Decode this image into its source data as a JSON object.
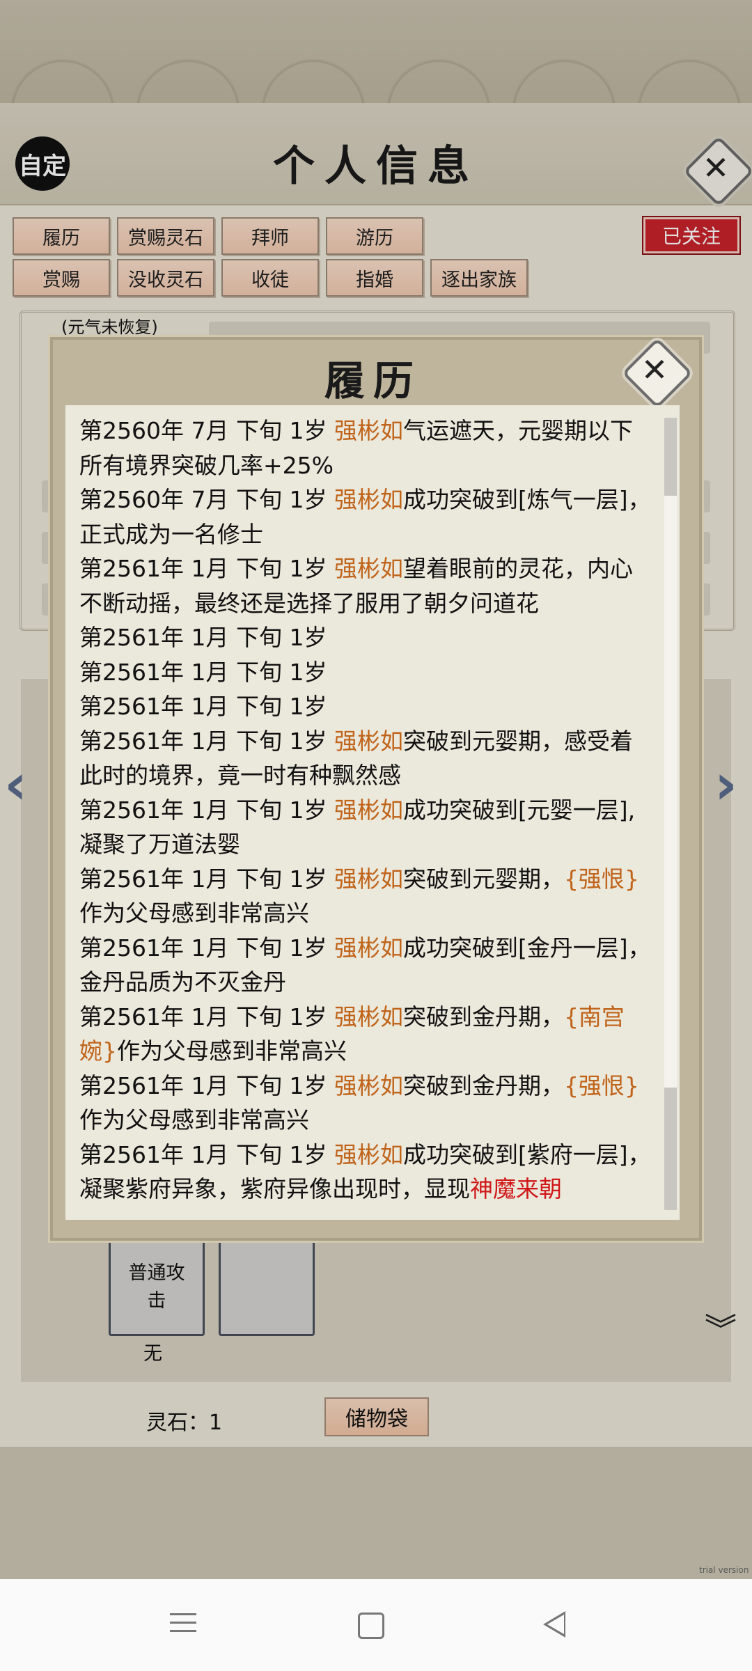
{
  "header": {
    "auto_label": "自定",
    "title": "个人信息"
  },
  "tabs_row1": [
    "履历",
    "赏赐灵石",
    "拜师",
    "游历"
  ],
  "tabs_row2": [
    "赏赐",
    "没收灵石",
    "收徒",
    "指婚",
    "逐出家族"
  ],
  "followed_label": "已关注",
  "status_note": "(元气未恢复)",
  "modal": {
    "title": "履历",
    "entries": [
      {
        "prefix": "第2560年 7月 下旬 1岁 ",
        "name": "强彬如",
        "text": "气运遮天，元婴期以下所有境界突破几率+25%"
      },
      {
        "prefix": "第2560年 7月 下旬 1岁 ",
        "name": "强彬如",
        "text": "成功突破到[炼气一层]，正式成为一名修士"
      },
      {
        "prefix": "第2561年 1月 下旬 1岁 ",
        "name": "强彬如",
        "text": "望着眼前的灵花，内心不断动摇，最终还是选择了服用了朝夕问道花"
      },
      {
        "prefix": "第2561年 1月 下旬 1岁",
        "name": "",
        "text": ""
      },
      {
        "prefix": "第2561年 1月 下旬 1岁",
        "name": "",
        "text": ""
      },
      {
        "prefix": "第2561年 1月 下旬 1岁",
        "name": "",
        "text": ""
      },
      {
        "prefix": "第2561年 1月 下旬 1岁 ",
        "name": "强彬如",
        "text": "突破到元婴期，感受着此时的境界，竟一时有种飘然感"
      },
      {
        "prefix": "第2561年 1月 下旬 1岁 ",
        "name": "强彬如",
        "text": "成功突破到[元婴一层],凝聚了万道法婴"
      },
      {
        "prefix": "第2561年 1月 下旬 1岁 ",
        "name": "强彬如",
        "text": "突破到元婴期，",
        "kin": "{强恨}",
        "tail": "作为父母感到非常高兴"
      },
      {
        "prefix": "第2561年 1月 下旬 1岁 ",
        "name": "强彬如",
        "text": "成功突破到[金丹一层]，金丹品质为不灭金丹"
      },
      {
        "prefix": "第2561年 1月 下旬 1岁 ",
        "name": "强彬如",
        "text": "突破到金丹期，",
        "kin": "{南宫婉}",
        "tail": "作为父母感到非常高兴"
      },
      {
        "prefix": "第2561年 1月 下旬 1岁 ",
        "name": "强彬如",
        "text": "突破到金丹期，",
        "kin": "{强恨}",
        "tail": "作为父母感到非常高兴"
      },
      {
        "prefix": "第2561年 1月 下旬 1岁 ",
        "name": "强彬如",
        "text": "成功突破到[紫府一层]，凝聚紫府异象，紫府异像出现时，显现",
        "red": "神魔来朝"
      }
    ]
  },
  "skills": {
    "slot1_label": "普通攻击",
    "slot1_caption": "无"
  },
  "footer": {
    "spirit_stones": "灵石：1",
    "bag_label": "储物袋"
  },
  "watermark": "trial version",
  "colors": {
    "name_orange": "#c0641a",
    "highlight_red": "#d01818",
    "followed_red": "#c8232b"
  }
}
